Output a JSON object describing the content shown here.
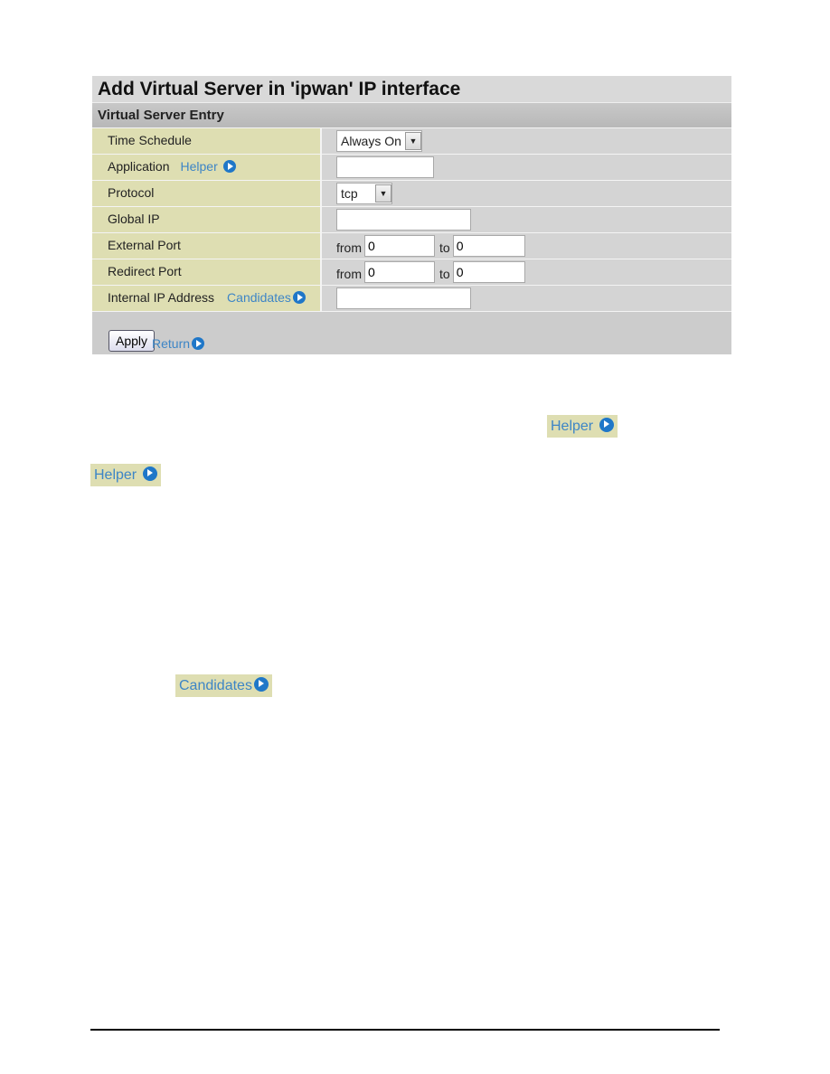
{
  "title": "Add Virtual Server in 'ipwan' IP interface",
  "section": "Virtual Server Entry",
  "rows": {
    "time_schedule": {
      "label": "Time Schedule",
      "value": "Always On"
    },
    "application": {
      "label": "Application",
      "link": "Helper",
      "value": ""
    },
    "protocol": {
      "label": "Protocol",
      "value": "tcp"
    },
    "global_ip": {
      "label": "Global IP",
      "value": ""
    },
    "external_port": {
      "label": "External Port",
      "from_label": "from",
      "from": "0",
      "to_label": "to",
      "to": "0"
    },
    "redirect_port": {
      "label": "Redirect Port",
      "from_label": "from",
      "from": "0",
      "to_label": "to",
      "to": "0"
    },
    "internal_ip": {
      "label": "Internal IP Address",
      "link": "Candidates",
      "value": ""
    }
  },
  "footer": {
    "apply": "Apply",
    "return": "Return"
  },
  "callouts": {
    "helper1": "Helper",
    "helper2": "Helper",
    "candidates": "Candidates"
  }
}
